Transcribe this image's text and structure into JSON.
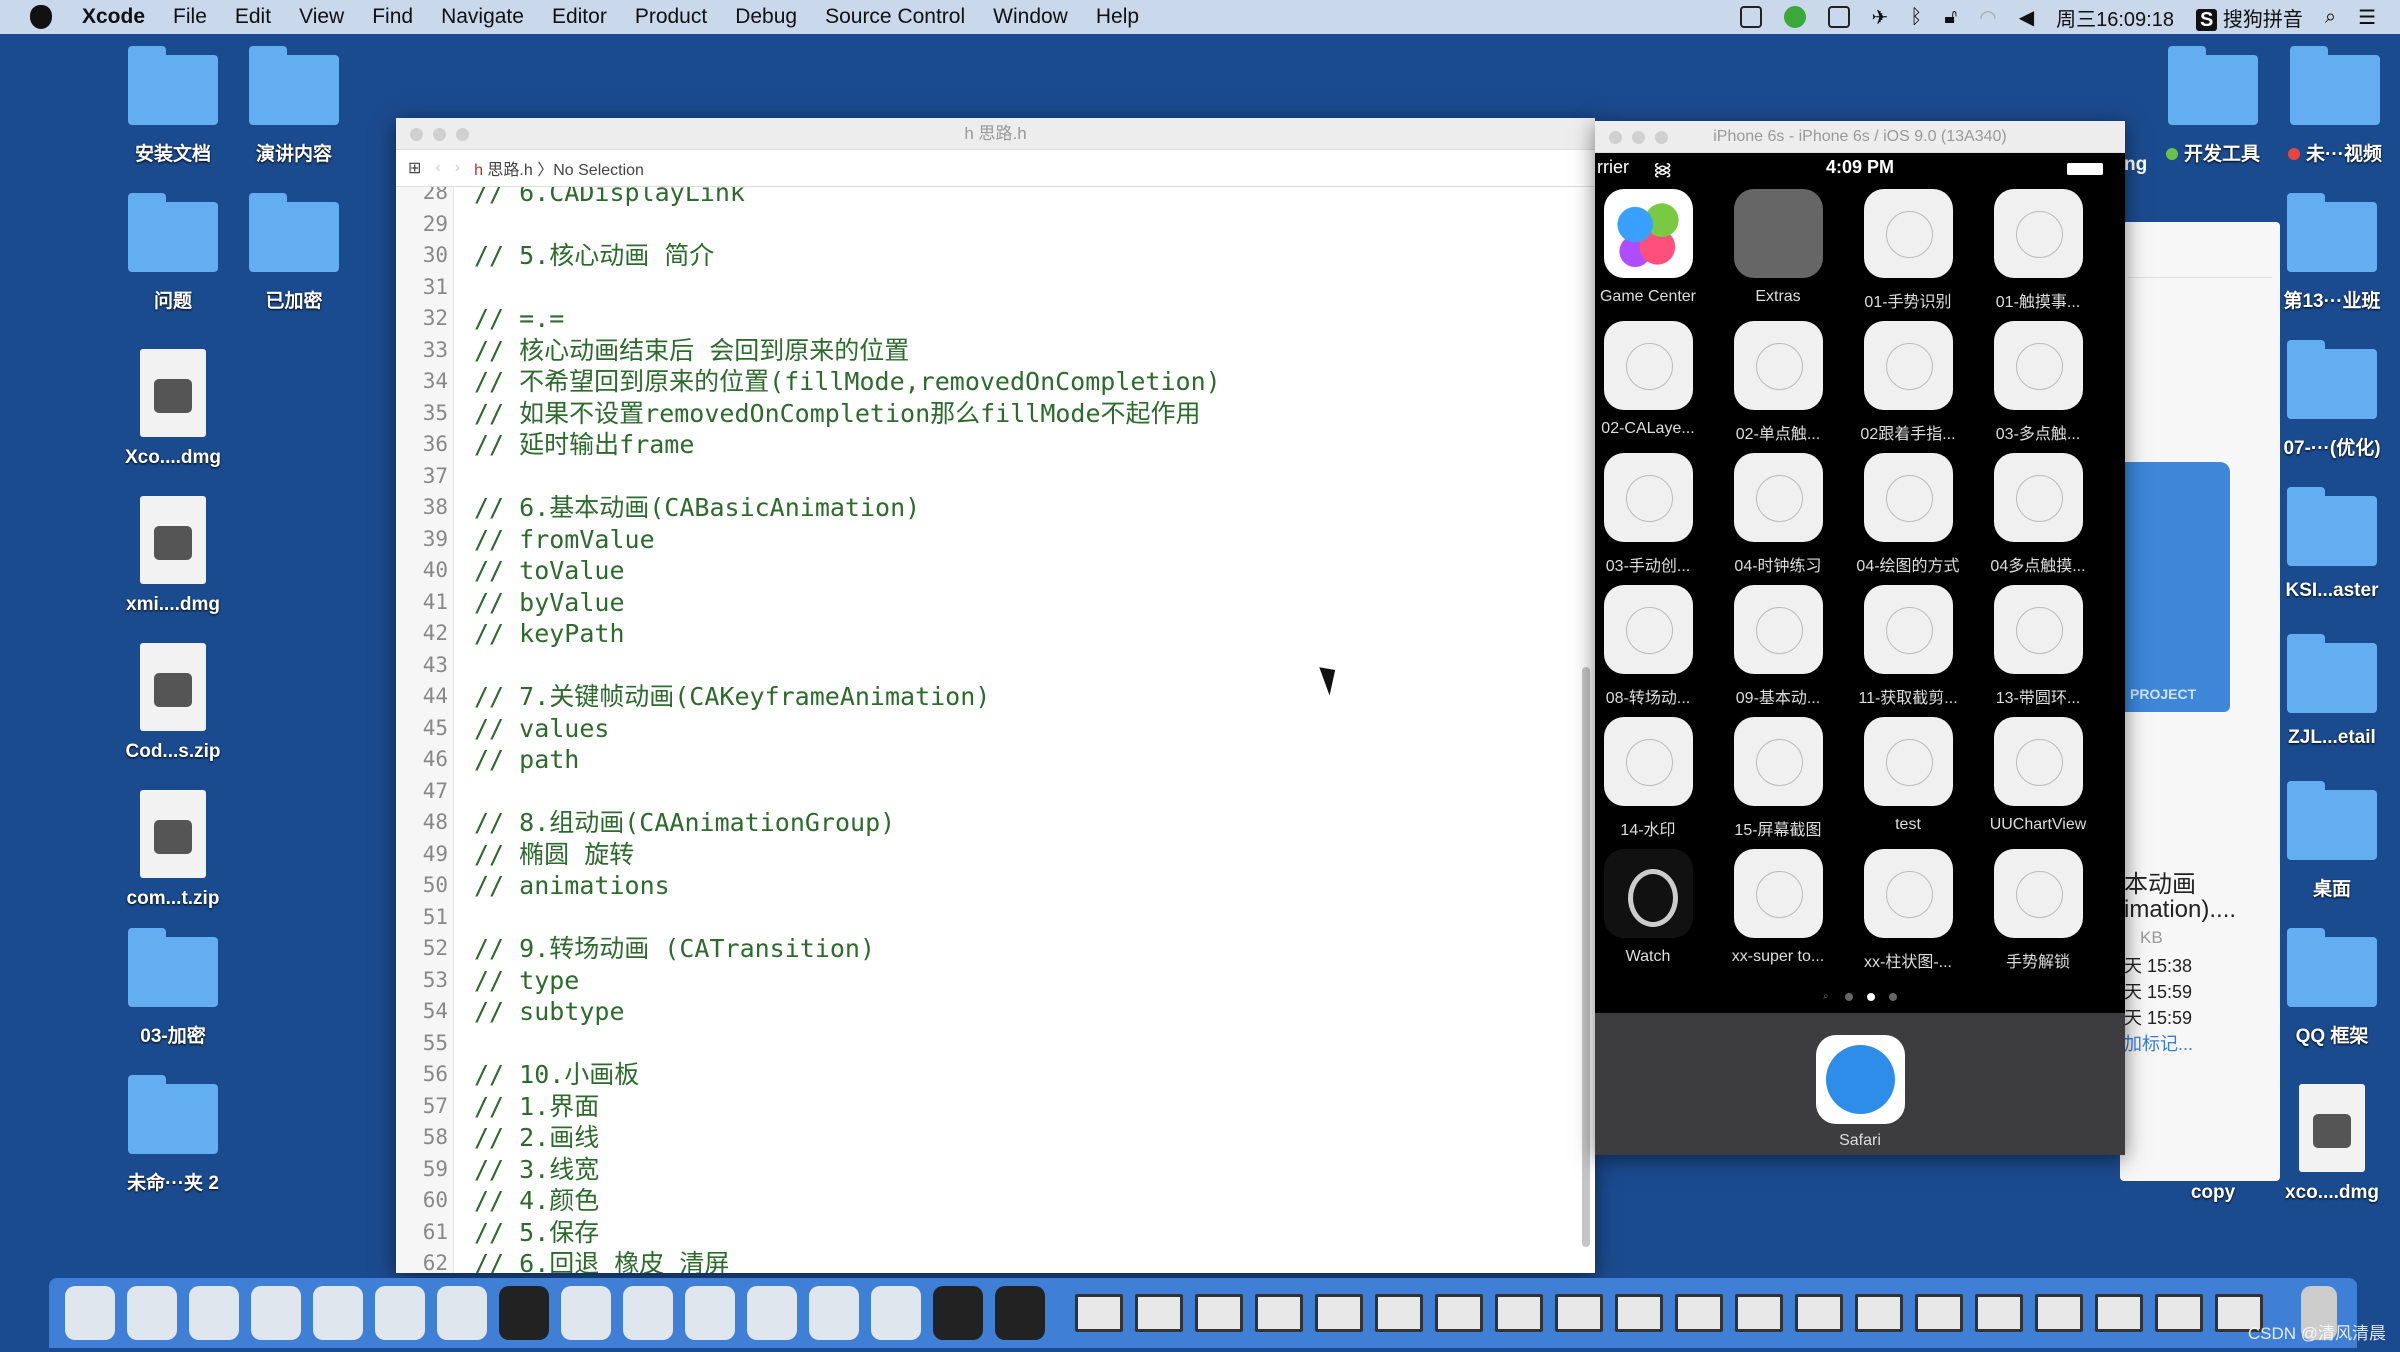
{
  "menubar": {
    "app": "Xcode",
    "items": [
      "File",
      "Edit",
      "View",
      "Find",
      "Navigate",
      "Editor",
      "Product",
      "Debug",
      "Source Control",
      "Window",
      "Help"
    ],
    "clock": "周三16:09:18",
    "ime": "搜狗拼音"
  },
  "desktop_left": [
    {
      "label": "安装文档",
      "type": "folder"
    },
    {
      "label": "演讲内容",
      "type": "folder"
    },
    {
      "label": "问题",
      "type": "folder"
    },
    {
      "label": "已加密",
      "type": "folder"
    },
    {
      "label": "Xco....dmg",
      "type": "file"
    },
    {
      "label": "xmi....dmg",
      "type": "file"
    },
    {
      "label": "Cod...s.zip",
      "type": "file"
    },
    {
      "label": "com...t.zip",
      "type": "file"
    },
    {
      "label": "03-加密",
      "type": "folder"
    },
    {
      "label": "未命···夹 2",
      "type": "folder"
    }
  ],
  "desktop_right": {
    "partial": "ng",
    "tag_green": "开发工具",
    "tag_red": "未···视频",
    "col2": [
      "第13···业班",
      "07-···(优化)",
      "KSI...aster",
      "ZJL...etail",
      "桌面",
      "QQ 框架",
      "xco....dmg"
    ],
    "copy": "copy",
    "tag_green_color": "#6cc04a",
    "tag_red_color": "#e8453c"
  },
  "xcode": {
    "title": "思路.h",
    "breadcrumb_file": "思路.h",
    "breadcrumb_sel": "No Selection",
    "lines": [
      [
        "28",
        "// 6.CADisplayLink"
      ],
      [
        "29",
        ""
      ],
      [
        "30",
        "// 5.核心动画 简介"
      ],
      [
        "31",
        ""
      ],
      [
        "32",
        "// =.="
      ],
      [
        "33",
        "// 核心动画结束后 会回到原来的位置"
      ],
      [
        "34",
        "// 不希望回到原来的位置(fillMode,removedOnCompletion)"
      ],
      [
        "35",
        "// 如果不设置removedOnCompletion那么fillMode不起作用"
      ],
      [
        "36",
        "// 延时输出frame"
      ],
      [
        "37",
        ""
      ],
      [
        "38",
        "// 6.基本动画(CABasicAnimation)"
      ],
      [
        "39",
        "// fromValue"
      ],
      [
        "40",
        "// toValue"
      ],
      [
        "41",
        "// byValue"
      ],
      [
        "42",
        "// keyPath"
      ],
      [
        "43",
        ""
      ],
      [
        "44",
        "// 7.关键帧动画(CAKeyframeAnimation)"
      ],
      [
        "45",
        "// values"
      ],
      [
        "46",
        "// path"
      ],
      [
        "47",
        ""
      ],
      [
        "48",
        "// 8.组动画(CAAnimationGroup)"
      ],
      [
        "49",
        "// 椭圆 旋转"
      ],
      [
        "50",
        "// animations"
      ],
      [
        "51",
        ""
      ],
      [
        "52",
        "// 9.转场动画 (CATransition)"
      ],
      [
        "53",
        "// type"
      ],
      [
        "54",
        "// subtype"
      ],
      [
        "55",
        ""
      ],
      [
        "56",
        "// 10.小画板"
      ],
      [
        "57",
        "// 1.界面"
      ],
      [
        "58",
        "// 2.画线"
      ],
      [
        "59",
        "// 3.线宽"
      ],
      [
        "60",
        "// 4.颜色"
      ],
      [
        "61",
        "// 5.保存"
      ],
      [
        "62",
        "// 6.回退 橡皮 清屏"
      ]
    ]
  },
  "simulator": {
    "title": "iPhone 6s - iPhone 6s / iOS 9.0 (13A340)",
    "carrier": "rrier",
    "time": "4:09 PM",
    "apps": [
      "Game Center",
      "Extras",
      "01-手势识别",
      "01-触摸事...",
      "02-CALaye...",
      "02-单点触...",
      "02跟着手指...",
      "03-多点触...",
      "03-手动创...",
      "04-时钟练习",
      "04-绘图的方式",
      "04多点触摸...",
      "08-转场动...",
      "09-基本动...",
      "11-获取截剪...",
      "13-带圆环...",
      "14-水印",
      "15-屏幕截图",
      "test",
      "UUChartView",
      "Watch",
      "xx-super to...",
      "xx-柱状图-...",
      "手势解锁"
    ],
    "dock_app": "Safari"
  },
  "finder_info": {
    "name1": "本动画",
    "name2": "imation)....",
    "size": "KB",
    "dates": [
      "天 15:38",
      "天 15:59",
      "天 15:59"
    ],
    "tags_link": "加标记...",
    "badge": "PROJECT"
  },
  "dock": {
    "apps": [
      "finder",
      "launchpad",
      "safari",
      "mouse",
      "photo-slideshow",
      "xcode",
      "xcode-beta",
      "terminal",
      "system-preferences",
      "sketch",
      "pages-p",
      "quicktime",
      "teamviewer",
      "ibooks",
      "console",
      "preview"
    ],
    "windows": 20
  },
  "watermark": "CSDN @清风清晨"
}
